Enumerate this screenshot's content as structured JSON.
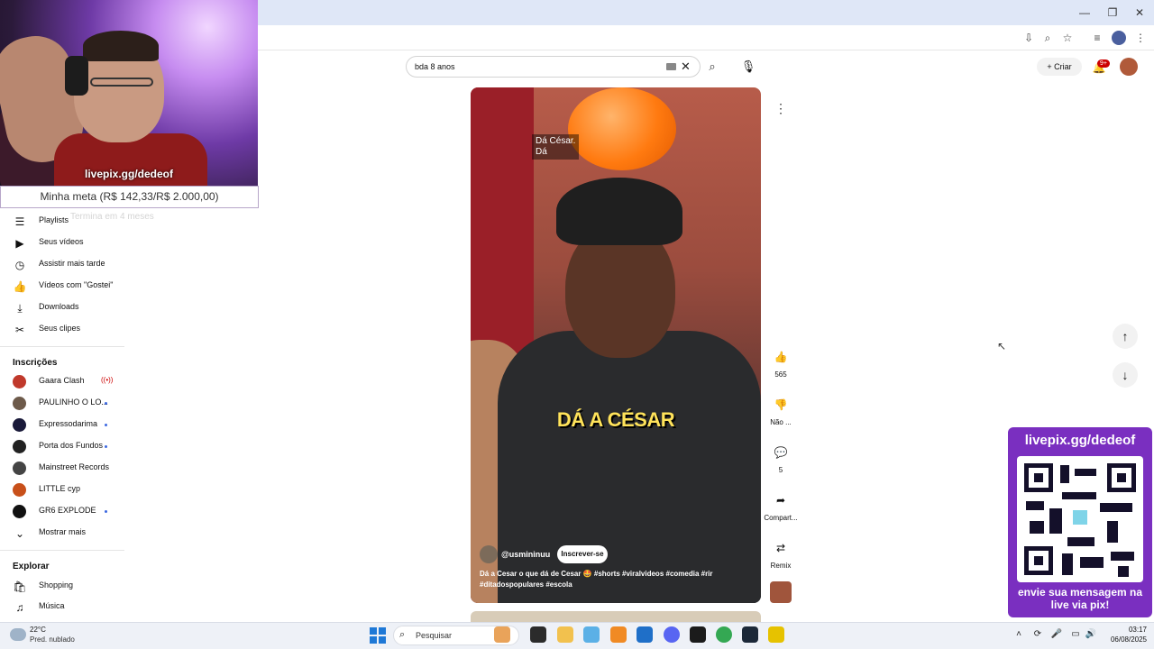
{
  "browser": {
    "window_controls": {
      "minimize": "—",
      "restore": "❐",
      "close": "✕"
    },
    "toolbar_icons": [
      "install-icon",
      "zoom-icon",
      "bookmark-star-icon",
      "media-icon",
      "profile-icon",
      "menu-icon"
    ]
  },
  "stream_overlay": {
    "webcam_label": "livepix.gg/dedeof",
    "goal_text": "Minha meta (R$ 142,33/R$ 2.000,00)",
    "goal_subtext": "Termina em 4 meses",
    "qr_top_text": "livepix.gg/dedeof",
    "qr_bottom_text": "envie sua mensagem na live via pix!"
  },
  "header": {
    "search_value": "bda 8 anos",
    "create_label": "Criar",
    "notifications_badge": "9+"
  },
  "sidebar": {
    "you_items": [
      {
        "label": "Playlists",
        "icon": "☰"
      },
      {
        "label": "Seus vídeos",
        "icon": "▶"
      },
      {
        "label": "Assistir mais tarde",
        "icon": "◷"
      },
      {
        "label": "Vídeos com \"Gostei\"",
        "icon": "👍"
      },
      {
        "label": "Downloads",
        "icon": "⤓"
      },
      {
        "label": "Seus clipes",
        "icon": "✂"
      }
    ],
    "subscriptions_heading": "Inscrições",
    "subscriptions": [
      {
        "label": "Gaara Clash",
        "color": "#c0392b",
        "status": "live",
        "live_icon": "((•))"
      },
      {
        "label": "PAULINHO O LO...",
        "color": "#6d5a4a",
        "status": "dot"
      },
      {
        "label": "Expressodarima",
        "color": "#1a1a3a",
        "status": "dot"
      },
      {
        "label": "Porta dos Fundos",
        "color": "#222222",
        "status": "dot"
      },
      {
        "label": "Mainstreet Records",
        "color": "#444444",
        "status": "none"
      },
      {
        "label": "LITTLE cyp",
        "color": "#c8501a",
        "status": "none"
      },
      {
        "label": "GR6 EXPLODE",
        "color": "#111111",
        "status": "dot"
      }
    ],
    "show_more": {
      "label": "Mostrar mais",
      "icon": "⌄"
    },
    "explore_heading": "Explorar",
    "explore_items": [
      {
        "label": "Shopping",
        "icon": "🛍"
      },
      {
        "label": "Música",
        "icon": "♫"
      }
    ]
  },
  "short": {
    "subtitle_top_line1": "Dá César.",
    "subtitle_top_line2": "Dá",
    "caption": "DÁ A CÉSAR",
    "channel_name": "@usmininuu",
    "subscribe_label": "Inscrever-se",
    "description": "Dá a Cesar o que dá de Cesar 🤩 #shorts #viralvideos #comedia #rir #ditadospopulares #escola"
  },
  "actions": {
    "like_count": "565",
    "dislike_label": "Não ...",
    "comments_count": "5",
    "share_label": "Compart...",
    "remix_label": "Remix"
  },
  "taskbar": {
    "weather_temp": "22°C",
    "weather_desc": "Pred. nublado",
    "search_placeholder": "Pesquisar",
    "time": "03:17",
    "date": "06/08/2025"
  }
}
